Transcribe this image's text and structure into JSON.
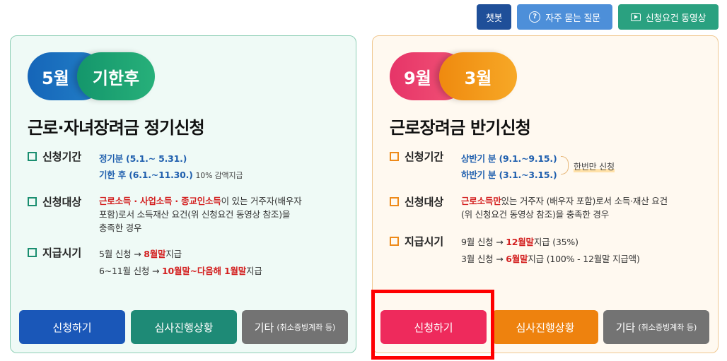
{
  "top": {
    "chatbot_label": "챗봇",
    "faq_label": "자주 묻는 질문",
    "video_label": "신청요건 동영상"
  },
  "regular": {
    "pill_month": "5월",
    "pill_sub": "기한후",
    "title": "근로·자녀장려금 정기신청",
    "period_label": "신청기간",
    "period_line1": "정기분 (5.1.~ 5.31.)",
    "period_line2_main": "기한 후 (6.1.~11.30.)",
    "period_line2_note": "10% 감액지급",
    "target_label": "신청대상",
    "target_red": "근로소득 · 사업소득 · 종교인소득",
    "target_rest1": "이 있는 거주자(배우자",
    "target_rest2": "포함)로서 소득재산 요건(위 신청요건 동영상 참조)을",
    "target_rest3": "충족한 경우",
    "pay_label": "지급시기",
    "pay1_pre": "5월 신청 → ",
    "pay1_red": "8월말",
    "pay1_post": "지급",
    "pay2_pre": "6~11월 신청 → ",
    "pay2_red": "10월말~다음해 1월말",
    "pay2_post": "지급",
    "btn_apply": "신청하기",
    "btn_status": "심사진행상황",
    "btn_etc": "기타",
    "btn_etc_sub": "(취소증빙계좌 등)"
  },
  "half": {
    "pill_month": "9월",
    "pill_sub": "3월",
    "title": "근로장려금 반기신청",
    "period_label": "신청기간",
    "period_line1": "상반기 분 (9.1.~9.15.)",
    "period_line2": "하반기 분 (3.1.~3.15.)",
    "period_note": "한번만 신청",
    "target_label": "신청대상",
    "target_red": "근로소득만",
    "target_rest1": "있는 거주자 (배우자 포함)로서 소득·재산 요건",
    "target_rest2": "(위 신청요건 동영상 참조)을 충족한 경우",
    "pay_label": "지급시기",
    "pay1_pre": "9월 신청 → ",
    "pay1_red": "12월말",
    "pay1_post": "지급 (35%)",
    "pay2_pre": "3월 신청 → ",
    "pay2_red": "6월말",
    "pay2_post": "지급 (100% - 12월말 지급액)",
    "btn_apply": "신청하기",
    "btn_status": "심사진행상황",
    "btn_etc": "기타",
    "btn_etc_sub": "(취소증빙계좌 등)"
  },
  "colors": {
    "regular_apply": "#1a57b8",
    "regular_status": "#1e8a76",
    "etc": "#737373",
    "half_apply": "#ee2a5c",
    "half_status": "#ee820e",
    "focus_box": "#ff0000"
  }
}
